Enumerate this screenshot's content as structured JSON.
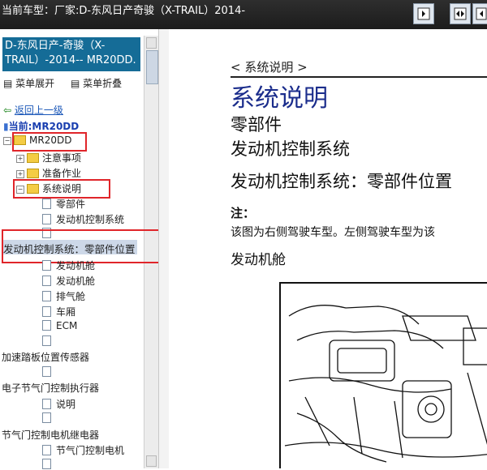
{
  "window": {
    "title": "当前车型：厂家:D-东风日产奇骏（X-TRAIL）2014-",
    "buttons": [
      "collapse-panel",
      "split-view",
      "expand-panel"
    ]
  },
  "left": {
    "breadcrumb": "D-东风日产-奇骏（X-TRAIL）-2014-- MR20DD.",
    "menu_expand": "菜单展开",
    "menu_collapse": "菜单折叠",
    "back": "返回上一级",
    "current": "当前:MR20DD",
    "tree": {
      "root": "MR20DD",
      "n1": "注意事项",
      "n2": "准备作业",
      "n3": "系统说明",
      "n4": "零部件",
      "n5": "发动机控制系统",
      "n6": "发动机控制系统：零部件位置",
      "n7": "发动机舱",
      "n8": "发动机舱",
      "n9": "排气舱",
      "n10": "车厢",
      "n11": "ECM",
      "n12": "加速踏板位置传感器",
      "n13": "电子节气门控制执行器",
      "n14": "说明",
      "n15": "节气门控制电机继电器",
      "n16": "节气门控制电机"
    }
  },
  "right": {
    "section_small": "< 系统说明 >",
    "h1": "系统说明",
    "h2_parts": "零部件",
    "h2_engine": "发动机控制系统",
    "h2_location": "发动机控制系统：零部件位置",
    "note_label": "注：",
    "note_text": "该图为右侧驾驶车型。左侧驾驶车型为该",
    "engine_bay": "发动机舱"
  }
}
